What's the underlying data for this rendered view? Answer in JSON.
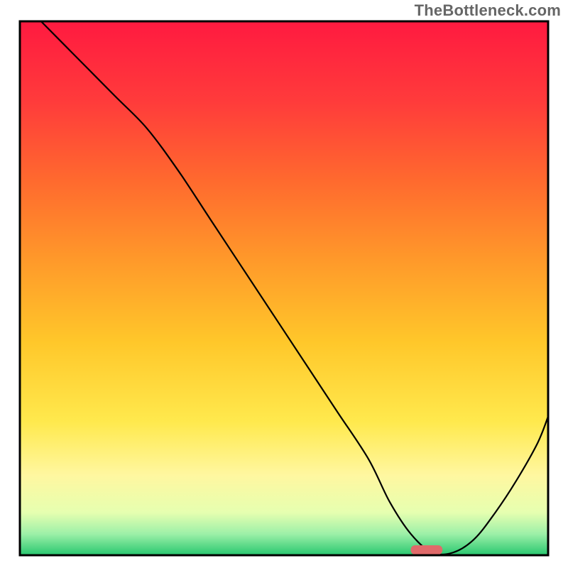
{
  "watermark": "TheBottleneck.com",
  "chart_data": {
    "type": "line",
    "title": "",
    "xlabel": "",
    "ylabel": "",
    "xlim": [
      0,
      100
    ],
    "ylim": [
      0,
      100
    ],
    "x": [
      4,
      10,
      18,
      24,
      30,
      36,
      42,
      48,
      54,
      60,
      66,
      70,
      74,
      78,
      82,
      86,
      90,
      94,
      98,
      100
    ],
    "values": [
      100,
      94,
      86,
      80,
      72,
      63,
      54,
      45,
      36,
      27,
      18,
      10,
      4,
      0.5,
      0.5,
      3,
      8,
      14,
      21,
      26
    ],
    "marker": {
      "x_start": 74,
      "x_end": 80,
      "y": 1
    },
    "background": {
      "type": "vertical-gradient",
      "stops": [
        {
          "pos": 0.0,
          "color": "#ff1a40"
        },
        {
          "pos": 0.15,
          "color": "#ff3b3b"
        },
        {
          "pos": 0.3,
          "color": "#ff6a2e"
        },
        {
          "pos": 0.45,
          "color": "#ff9a2a"
        },
        {
          "pos": 0.6,
          "color": "#ffc72a"
        },
        {
          "pos": 0.75,
          "color": "#ffe94d"
        },
        {
          "pos": 0.85,
          "color": "#fff7a0"
        },
        {
          "pos": 0.92,
          "color": "#e6ffb0"
        },
        {
          "pos": 0.96,
          "color": "#9df0a8"
        },
        {
          "pos": 1.0,
          "color": "#28c76f"
        }
      ]
    }
  }
}
